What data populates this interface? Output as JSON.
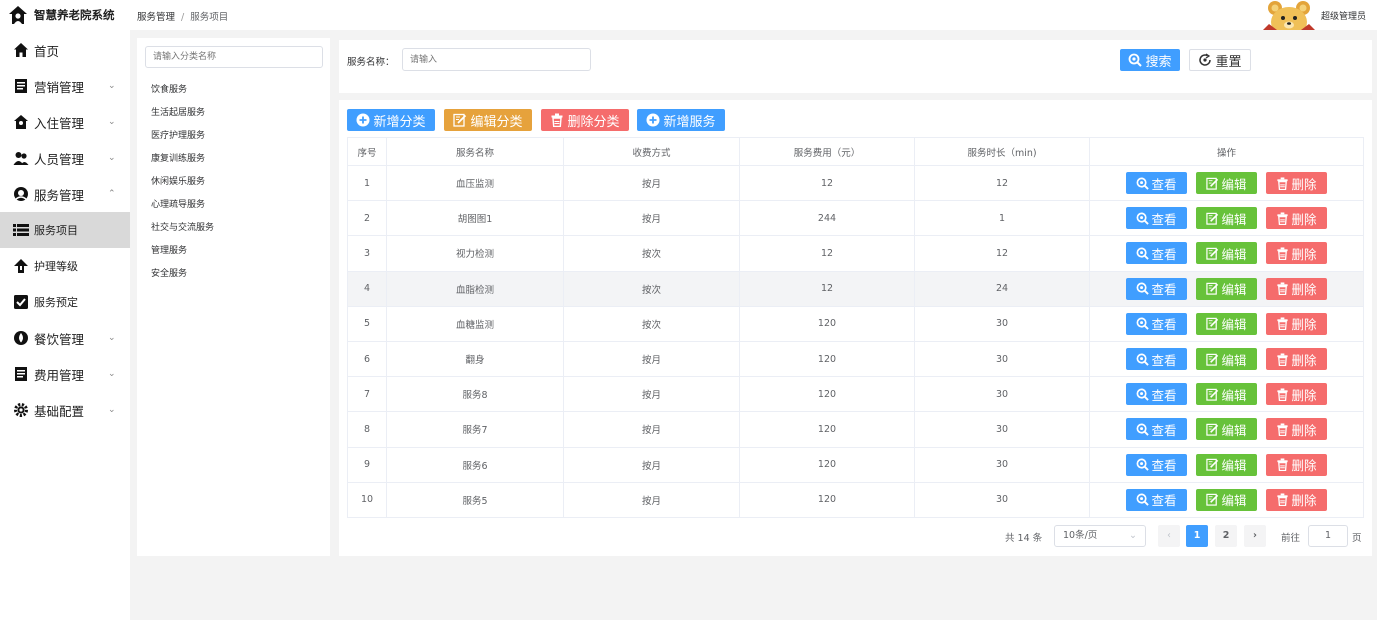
{
  "app": {
    "title": "智慧养老院系统"
  },
  "breadcrumb": {
    "parent": "服务管理",
    "separator": "/",
    "current": "服务项目"
  },
  "user": {
    "name": "超级管理员"
  },
  "sidebar": {
    "items": [
      {
        "label": "首页",
        "icon": "home-icon"
      },
      {
        "label": "营销管理",
        "icon": "document-icon",
        "arrow": "⌄"
      },
      {
        "label": "入住管理",
        "icon": "house-icon",
        "arrow": "⌄"
      },
      {
        "label": "人员管理",
        "icon": "people-icon",
        "arrow": "⌄"
      },
      {
        "label": "服务管理",
        "icon": "service-icon",
        "arrow": "⌃"
      },
      {
        "label": "服务项目",
        "icon": "list-icon"
      },
      {
        "label": "护理等级",
        "icon": "arrow-up-icon"
      },
      {
        "label": "服务预定",
        "icon": "checkbox-icon"
      },
      {
        "label": "餐饮管理",
        "icon": "droplet-icon",
        "arrow": "⌄"
      },
      {
        "label": "费用管理",
        "icon": "document-icon",
        "arrow": "⌄"
      },
      {
        "label": "基础配置",
        "icon": "gear-icon",
        "arrow": "⌄"
      }
    ]
  },
  "categories": {
    "search_placeholder": "请输入分类名称",
    "items": [
      "饮食服务",
      "生活起居服务",
      "医疗护理服务",
      "康复训练服务",
      "休闲娱乐服务",
      "心理疏导服务",
      "社交与交流服务",
      "管理服务",
      "安全服务"
    ]
  },
  "search": {
    "label": "服务名称：",
    "placeholder": "请输入",
    "search_button": "搜索",
    "reset_button": "重置"
  },
  "toolbar": {
    "add_category": "新增分类",
    "edit_category": "编辑分类",
    "delete_category": "删除分类",
    "add_service": "新增服务"
  },
  "table": {
    "columns": [
      "序号",
      "服务名称",
      "收费方式",
      "服务费用（元）",
      "服务时长（min)",
      "操作"
    ],
    "actions": {
      "view": "查看",
      "edit": "编辑",
      "delete": "删除"
    },
    "rows": [
      {
        "no": "1",
        "name": "血压监测",
        "billing": "按月",
        "fee": "12",
        "duration": "12"
      },
      {
        "no": "2",
        "name": "胡图图1",
        "billing": "按月",
        "fee": "244",
        "duration": "1"
      },
      {
        "no": "3",
        "name": "视力检测",
        "billing": "按次",
        "fee": "12",
        "duration": "12"
      },
      {
        "no": "4",
        "name": "血脂检测",
        "billing": "按次",
        "fee": "12",
        "duration": "24"
      },
      {
        "no": "5",
        "name": "血糖监测",
        "billing": "按次",
        "fee": "120",
        "duration": "30"
      },
      {
        "no": "6",
        "name": "翻身",
        "billing": "按月",
        "fee": "120",
        "duration": "30"
      },
      {
        "no": "7",
        "name": "服务8",
        "billing": "按月",
        "fee": "120",
        "duration": "30"
      },
      {
        "no": "8",
        "name": "服务7",
        "billing": "按月",
        "fee": "120",
        "duration": "30"
      },
      {
        "no": "9",
        "name": "服务6",
        "billing": "按月",
        "fee": "120",
        "duration": "30"
      },
      {
        "no": "10",
        "name": "服务5",
        "billing": "按月",
        "fee": "120",
        "duration": "30"
      }
    ]
  },
  "pagination": {
    "total": "共 14 条",
    "page_size": "10条/页",
    "prev": "‹",
    "next": "›",
    "pages": [
      "1",
      "2"
    ],
    "current_page": "1",
    "goto_label": "前往",
    "goto_value": "1",
    "goto_unit": "页"
  },
  "colors": {
    "primary": "#409eff",
    "success": "#67c23a",
    "warning": "#e6a23c",
    "danger": "#f56c6c",
    "active_nav": "#d9d9d9"
  }
}
